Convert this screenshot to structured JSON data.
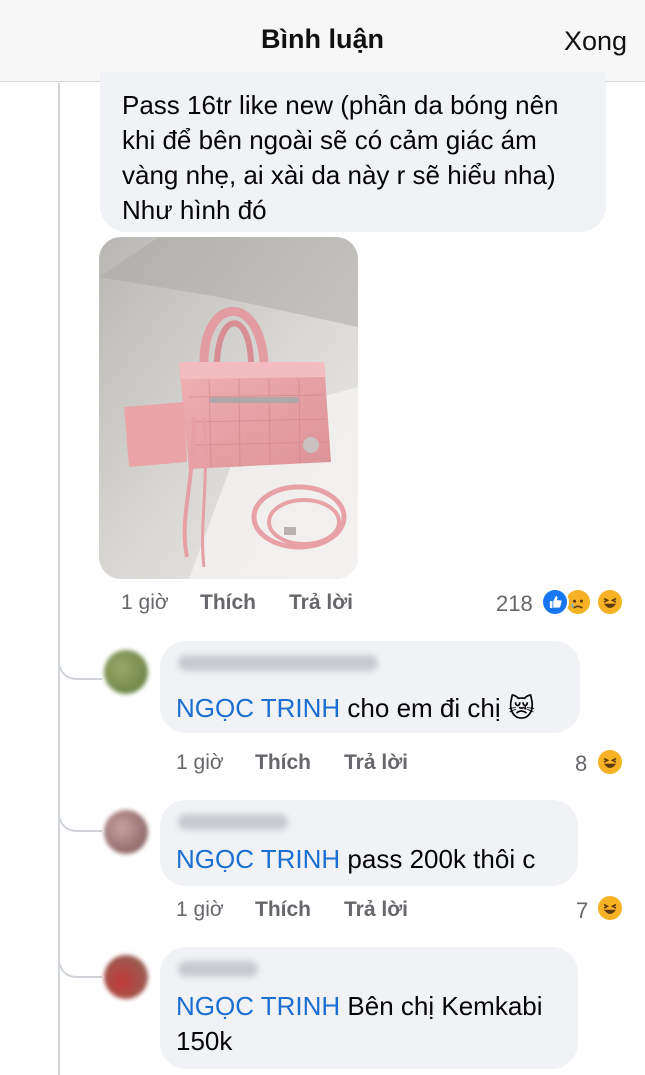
{
  "header": {
    "title": "Bình luận",
    "done_label": "Xong"
  },
  "main_comment": {
    "lines": [
      "Pass 16tr like new (phần da bóng nên",
      "khi để bên ngoài sẽ có cảm giác ám",
      "vàng nhẹ, ai xài da này r sẽ hiểu nha)",
      "Như hình đó"
    ],
    "time": "1 giờ",
    "like_label": "Thích",
    "reply_label": "Trả lời",
    "reaction_count": "218",
    "reactions": [
      "like-icon",
      "sad-icon",
      "haha-icon"
    ]
  },
  "replies": [
    {
      "mention": "NGỌC TRINH",
      "text": " cho em đi chị 😿",
      "time": "1 giờ",
      "like_label": "Thích",
      "reply_label": "Trả lời",
      "reaction_count": "8"
    },
    {
      "mention": "NGỌC TRINH",
      "text": " pass 200k thôi c",
      "time": "1 giờ",
      "like_label": "Thích",
      "reply_label": "Trả lời",
      "reaction_count": "7"
    },
    {
      "mention": "NGỌC TRINH",
      "text_line1": " Bên chị Kemkabi",
      "text_line2": "150k"
    }
  ],
  "colors": {
    "accent": "#1b6fd1",
    "bubble": "#f0f2f5",
    "muted": "#65676b",
    "bag": "#e9a3a8"
  }
}
